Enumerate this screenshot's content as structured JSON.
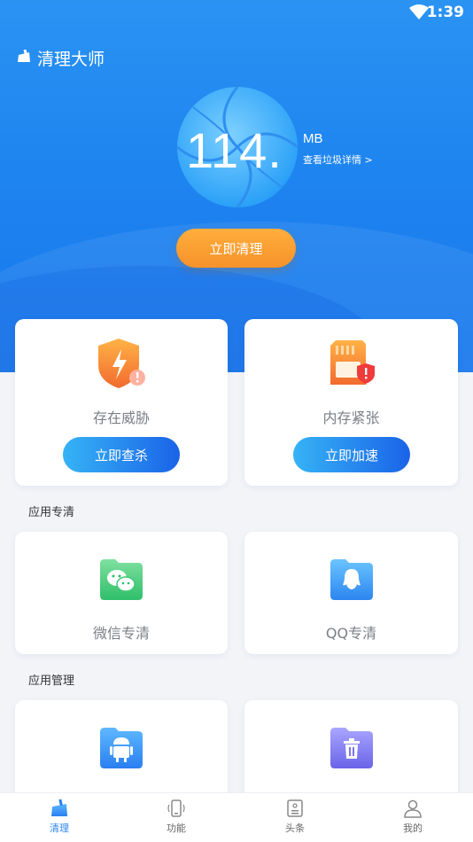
{
  "status_bar": {
    "time": "1:39"
  },
  "app": {
    "title": "清理大师"
  },
  "hero": {
    "size_value": "114.",
    "size_unit": "MB",
    "detail_link": "查看垃圾详情 >",
    "clean_button": "立即清理"
  },
  "cards_top": [
    {
      "label": "存在威胁",
      "button": "立即查杀",
      "icon": "shield-warning-icon"
    },
    {
      "label": "内存紧张",
      "button": "立即加速",
      "icon": "memory-card-icon"
    }
  ],
  "sections": {
    "app_clean": "应用专清",
    "app_manage": "应用管理"
  },
  "app_clean_cards": [
    {
      "label": "微信专清",
      "icon": "wechat-icon"
    },
    {
      "label": "QQ专清",
      "icon": "qq-icon"
    }
  ],
  "app_manage_cards": [
    {
      "icon": "android-icon"
    },
    {
      "icon": "trash-icon"
    }
  ],
  "tabbar": [
    {
      "label": "清理",
      "icon": "broom-icon",
      "active": true
    },
    {
      "label": "功能",
      "icon": "phone-icon",
      "active": false
    },
    {
      "label": "头条",
      "icon": "news-icon",
      "active": false
    },
    {
      "label": "我的",
      "icon": "user-icon",
      "active": false
    }
  ],
  "colors": {
    "primary_blue": "#2a87f0",
    "orange": "#f7922a",
    "text_gray": "#7b7f86"
  }
}
